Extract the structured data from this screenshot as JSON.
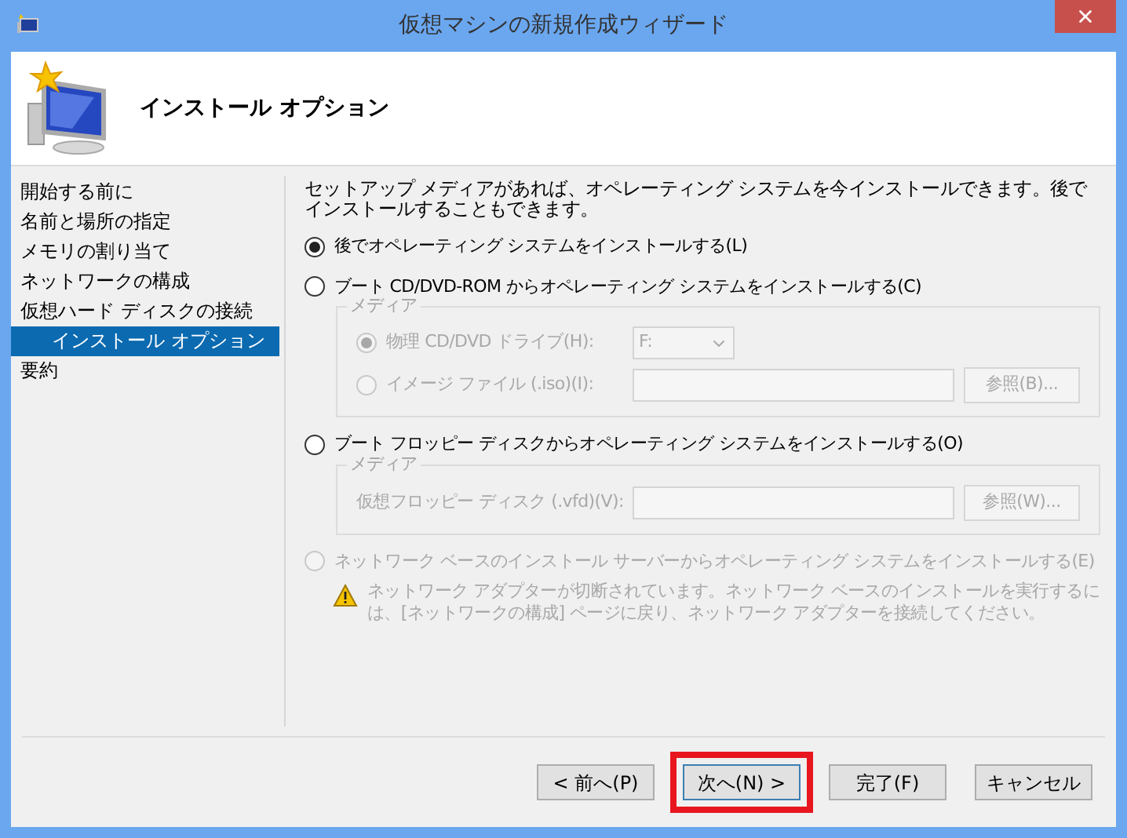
{
  "window": {
    "title": "仮想マシンの新規作成ウィザード"
  },
  "header": {
    "title": "インストール オプション"
  },
  "steps": [
    {
      "label": "開始する前に",
      "selected": false
    },
    {
      "label": "名前と場所の指定",
      "selected": false
    },
    {
      "label": "メモリの割り当て",
      "selected": false
    },
    {
      "label": "ネットワークの構成",
      "selected": false
    },
    {
      "label": "仮想ハード ディスクの接続",
      "selected": false
    },
    {
      "label": "インストール オプション",
      "selected": true
    },
    {
      "label": "要約",
      "selected": false
    }
  ],
  "intro": "セットアップ メディアがあれば、オペレーティング システムを今インストールできます。後でインストールすることもできます。",
  "options": [
    {
      "kind": "plain",
      "label": "後でオペレーティング システムをインストールする(L)",
      "selected": true,
      "disabled": false
    },
    {
      "kind": "cd",
      "label": "ブート CD/DVD-ROM からオペレーティング システムをインストールする(C)",
      "selected": false,
      "disabled": false,
      "media": {
        "legend": "メディア",
        "drive": {
          "label": "物理 CD/DVD ドライブ(H):",
          "selected": true,
          "value": "F:"
        },
        "image": {
          "label": "イメージ ファイル (.iso)(I):",
          "selected": false,
          "button": "参照(B)..."
        }
      }
    },
    {
      "kind": "floppy",
      "label": "ブート フロッピー ディスクからオペレーティング システムをインストールする(O)",
      "selected": false,
      "disabled": false,
      "media": {
        "legend": "メディア",
        "file": {
          "label": "仮想フロッピー ディスク (.vfd)(V):",
          "button": "参照(W)..."
        }
      }
    },
    {
      "kind": "network",
      "label": "ネットワーク ベースのインストール サーバーからオペレーティング システムをインストールする(E)",
      "selected": false,
      "disabled": true,
      "warning": "ネットワーク アダプターが切断されています。ネットワーク ベースのインストールを実行するには、[ネットワークの構成] ページに戻り、ネットワーク アダプターを接続してください。"
    }
  ],
  "buttons": [
    {
      "label": "< 前へ(P)",
      "highlighted": false,
      "focused": false
    },
    {
      "label": "次へ(N) >",
      "highlighted": true,
      "focused": true
    },
    {
      "label": "完了(F)",
      "highlighted": false,
      "focused": false
    },
    {
      "label": "キャンセル",
      "highlighted": false,
      "focused": false
    }
  ]
}
